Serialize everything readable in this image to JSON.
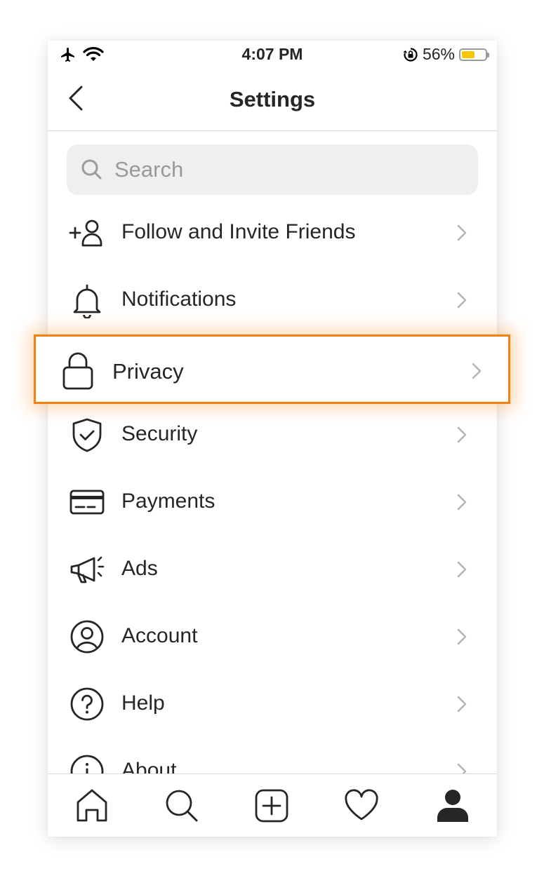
{
  "status_bar": {
    "time": "4:07 PM",
    "battery_percent": "56%",
    "battery_level": 0.56,
    "battery_color": "#f7c600"
  },
  "nav": {
    "title": "Settings"
  },
  "search": {
    "placeholder": "Search"
  },
  "menu": [
    {
      "label": "Follow and Invite Friends",
      "icon": "add-person-icon"
    },
    {
      "label": "Notifications",
      "icon": "bell-icon"
    },
    {
      "label": "Privacy",
      "icon": "lock-icon",
      "highlighted": true
    },
    {
      "label": "Security",
      "icon": "shield-check-icon"
    },
    {
      "label": "Payments",
      "icon": "credit-card-icon"
    },
    {
      "label": "Ads",
      "icon": "megaphone-icon"
    },
    {
      "label": "Account",
      "icon": "account-circle-icon"
    },
    {
      "label": "Help",
      "icon": "help-circle-icon"
    },
    {
      "label": "About",
      "icon": "info-circle-icon"
    }
  ],
  "tabs": [
    {
      "name": "home",
      "icon": "home-icon"
    },
    {
      "name": "search",
      "icon": "search-icon"
    },
    {
      "name": "new-post",
      "icon": "plus-square-icon"
    },
    {
      "name": "activity",
      "icon": "heart-icon"
    },
    {
      "name": "profile",
      "icon": "profile-icon",
      "active": true
    }
  ],
  "colors": {
    "highlight_border": "#f47f12",
    "text": "#262626",
    "divider": "#dbdbdb",
    "search_bg": "#efefef"
  }
}
